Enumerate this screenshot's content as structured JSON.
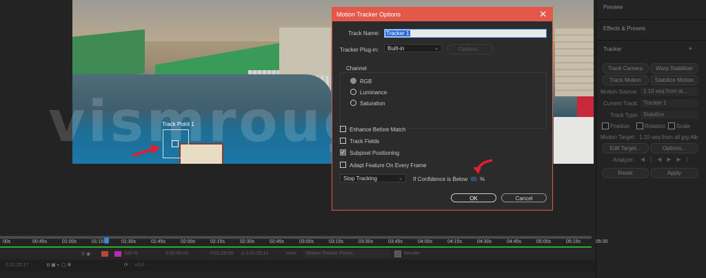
{
  "viewer": {
    "watermark": "vismrouge.r",
    "track_point_label": "Track Point 1"
  },
  "dialog": {
    "title": "Motion Tracker Options",
    "close_glyph": "✕",
    "track_name_label": "Track Name:",
    "track_name_value": "Tracker 1",
    "plugin_label": "Tracker Plug-in:",
    "plugin_value": "Built-in",
    "options_label": "Options...",
    "channel_label": "Channel",
    "channel_options": [
      "RGB",
      "Luminance",
      "Saturation"
    ],
    "channel_selected": "RGB",
    "checkboxes": [
      {
        "label": "Enhance Before Match",
        "checked": false
      },
      {
        "label": "Track Fields",
        "checked": false
      },
      {
        "label": "Subpixel Positioning",
        "checked": true
      },
      {
        "label": "Adapt Feature On Every Frame",
        "checked": false
      }
    ],
    "stop_tracking_value": "Stop Tracking",
    "confidence_label": "If Confidence is Below",
    "confidence_value": "85",
    "confidence_unit": "%",
    "ok_label": "OK",
    "cancel_label": "Cancel"
  },
  "right_panel": {
    "preview_title": "Preview",
    "effects_title": "Effects & Presets",
    "tracker_title": "Tracker",
    "menu_glyph": "≡",
    "track_camera": "Track Camera",
    "warp_stabilizer": "Warp Stabilizer",
    "track_motion": "Track Motion",
    "stabilize_motion": "Stabilize Motion",
    "motion_source_label": "Motion Source:",
    "motion_source_value": "1.10 seq from al...",
    "current_track_label": "Current Track:",
    "current_track_value": "Tracker 1",
    "track_type_label": "Track Type:",
    "track_type_value": "Stabilize",
    "position_label": "Position",
    "rotation_label": "Rotation",
    "scale_label": "Scale",
    "motion_target_label": "Motion Target:",
    "motion_target_value": "1.10 seq from all jpg Alb",
    "edit_target": "Edit Target...",
    "options": "Options...",
    "analyze_label": "Analyze:",
    "reset": "Reset",
    "apply": "Apply"
  },
  "timeline": {
    "ticks": [
      "00s",
      "00:45s",
      "01:00s",
      "01:15s",
      "01:30s",
      "01:45s",
      "02:00s",
      "02:15s",
      "02:30s",
      "02:45s",
      "03:00s",
      "03:15s",
      "03:30s",
      "03:45s",
      "04:00s",
      "04:15s",
      "04:30s",
      "04:45s",
      "05:00s",
      "05:15s",
      "05:30"
    ],
    "zoom": "100 %",
    "time_a": "0:00:00:00",
    "time_b": "0:01:29:09",
    "time_c": "Δ 0:01:29:10",
    "view_label": "View:",
    "view_value": "Motion Tracker Points",
    "render_label": "Render",
    "current_time": "0:01:25:17",
    "offset": "+0.0"
  },
  "colors": {
    "accent_red": "#e4584a",
    "confidence_blue": "#4a8fe0",
    "timeline_green": "#2fae2f"
  }
}
